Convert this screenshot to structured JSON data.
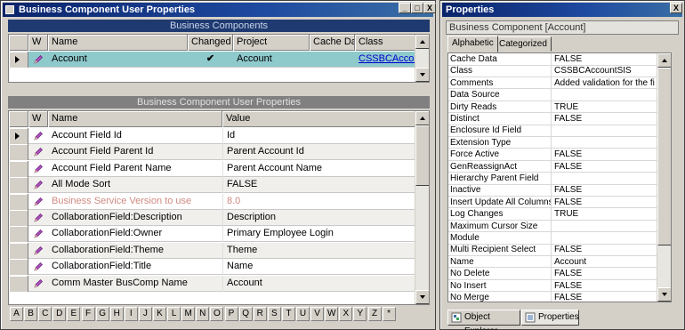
{
  "left_window": {
    "title": "Business Component User Properties",
    "controls": [
      "_",
      "□",
      "X"
    ],
    "top_grid": {
      "section_title": "Business Components",
      "headers": [
        "W",
        "Name",
        "Changed",
        "Project",
        "Cache Da",
        "Class"
      ],
      "rows": [
        {
          "name": "Account",
          "changed": "✔",
          "project": "Account",
          "cache": "",
          "class": "CSSBCAccountSIS"
        }
      ]
    },
    "bottom_grid": {
      "section_title": "Business Component User Properties",
      "headers": [
        "W",
        "Name",
        "Value"
      ],
      "rows": [
        {
          "name": "Account Field Id",
          "value": "Id"
        },
        {
          "name": "Account Field Parent Id",
          "value": "Parent Account Id"
        },
        {
          "name": "Account Field Parent Name",
          "value": "Parent Account Name"
        },
        {
          "name": "All Mode Sort",
          "value": "FALSE"
        },
        {
          "name": "Business Service Version to use",
          "value": "8.0",
          "inactive": true
        },
        {
          "name": "CollaborationField:Description",
          "value": "Description"
        },
        {
          "name": "CollaborationField:Owner",
          "value": "Primary Employee Login"
        },
        {
          "name": "CollaborationField:Theme",
          "value": "Theme"
        },
        {
          "name": "CollaborationField:Title",
          "value": "Name"
        },
        {
          "name": "Comm Master BusComp Name",
          "value": "Account"
        }
      ]
    },
    "alphabet": [
      "A",
      "B",
      "C",
      "D",
      "E",
      "F",
      "G",
      "H",
      "I",
      "J",
      "K",
      "L",
      "M",
      "N",
      "O",
      "P",
      "Q",
      "R",
      "S",
      "T",
      "U",
      "V",
      "W",
      "X",
      "Y",
      "Z",
      "*"
    ]
  },
  "right_window": {
    "title": "Properties",
    "close": "X",
    "object_label": "Business Component [Account]",
    "tabs": [
      "Alphabetic",
      "Categorized"
    ],
    "properties": [
      {
        "name": "Cache Data",
        "value": "FALSE"
      },
      {
        "name": "Class",
        "value": "CSSBCAccountSIS"
      },
      {
        "name": "Comments",
        "value": "Added validation for the fi"
      },
      {
        "name": "Data Source",
        "value": ""
      },
      {
        "name": "Dirty Reads",
        "value": "TRUE"
      },
      {
        "name": "Distinct",
        "value": "FALSE"
      },
      {
        "name": "Enclosure Id Field",
        "value": ""
      },
      {
        "name": "Extension Type",
        "value": ""
      },
      {
        "name": "Force Active",
        "value": "FALSE"
      },
      {
        "name": "GenReassignAct",
        "value": "FALSE"
      },
      {
        "name": "Hierarchy Parent Field",
        "value": ""
      },
      {
        "name": "Inactive",
        "value": "FALSE"
      },
      {
        "name": "Insert Update All Columns",
        "value": "FALSE"
      },
      {
        "name": "Log Changes",
        "value": "TRUE"
      },
      {
        "name": "Maximum Cursor Size",
        "value": ""
      },
      {
        "name": "Module",
        "value": ""
      },
      {
        "name": "Multi Recipient Select",
        "value": "FALSE"
      },
      {
        "name": "Name",
        "value": "Account"
      },
      {
        "name": "No Delete",
        "value": "FALSE"
      },
      {
        "name": "No Insert",
        "value": "FALSE"
      },
      {
        "name": "No Merge",
        "value": "FALSE"
      }
    ],
    "bottom_tabs": [
      "Object Explorer",
      "Properties"
    ]
  },
  "colors": {
    "titlebar": "#0a246a",
    "section_active": "#1f3a70",
    "selected_row": "#8ec9cc",
    "link": "#0000cc",
    "inactive_text": "#d08a82"
  },
  "icons": {
    "row_edit": "pencil-icon",
    "changed": "check-icon",
    "current_row": "arrow-right-icon"
  }
}
